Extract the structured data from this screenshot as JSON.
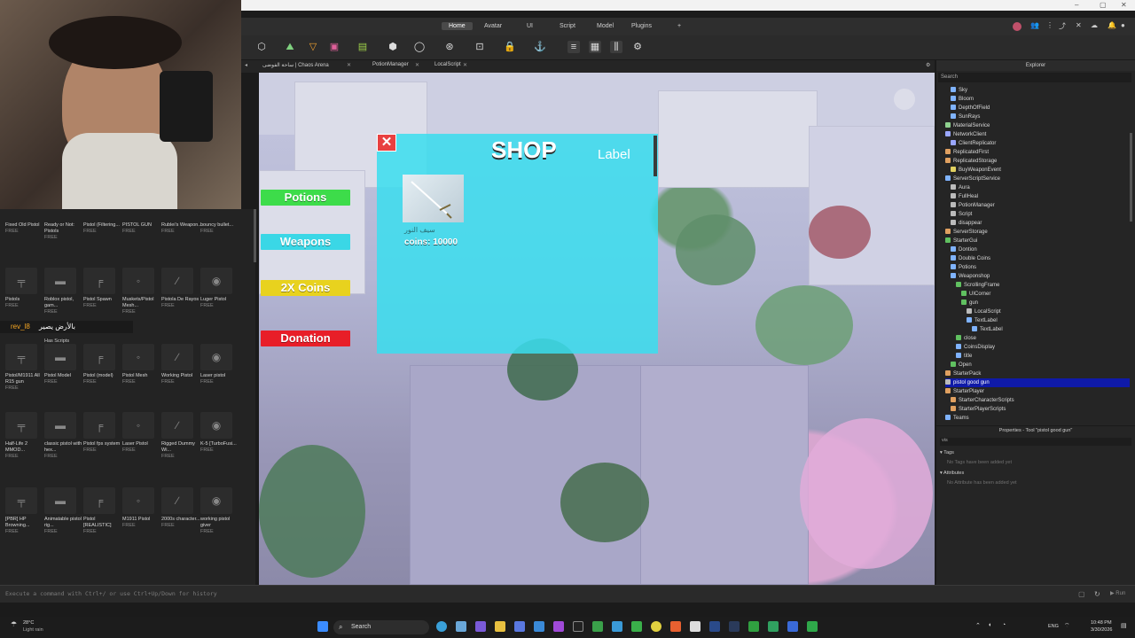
{
  "ribbon": {
    "tabs": [
      "Home",
      "Avatar",
      "UI",
      "Script",
      "Model",
      "Plugins",
      "+"
    ],
    "active": "Home"
  },
  "doc_tabs": [
    "ساحة الفوضى | Chaos Arena",
    "PotionManager",
    "LocalScript"
  ],
  "toolbox": {
    "overlay_user": "rev_l8",
    "overlay_msg": "بالأرض يصير",
    "has_scripts": "Has Scripts",
    "items": [
      {
        "name": "Fixed Old Pistol",
        "price": "FREE"
      },
      {
        "name": "Ready or Not: Pistols",
        "price": "FREE"
      },
      {
        "name": "Pistol (Filtering...",
        "price": "FREE"
      },
      {
        "name": "PISTOL GUN",
        "price": "FREE"
      },
      {
        "name": "Rublei's Weapon...",
        "price": "FREE"
      },
      {
        "name": "bouncy bullet...",
        "price": "FREE"
      },
      {
        "name": "Pistols",
        "price": "FREE"
      },
      {
        "name": "Roblox pistol, gam...",
        "price": "FREE"
      },
      {
        "name": "Pistol Spawn",
        "price": "FREE"
      },
      {
        "name": "Muskets/Pistol Mesh...",
        "price": "FREE"
      },
      {
        "name": "Pistola De Rayos",
        "price": "FREE"
      },
      {
        "name": "Luger Pistol",
        "price": "FREE"
      },
      {
        "name": "Pistol/M1911 All R15 gun",
        "price": "FREE"
      },
      {
        "name": "Pistol Model",
        "price": "FREE"
      },
      {
        "name": "Pistol (model)",
        "price": "FREE"
      },
      {
        "name": "Pistol Mesh",
        "price": "FREE"
      },
      {
        "name": "Working Pistol",
        "price": "FREE"
      },
      {
        "name": "Laser pistol",
        "price": "FREE"
      },
      {
        "name": "Half-Life 2 MMOD...",
        "price": "FREE"
      },
      {
        "name": "classic pistol with hex...",
        "price": "FREE"
      },
      {
        "name": "Pistol fps system",
        "price": "FREE"
      },
      {
        "name": "Laser Pistol",
        "price": "FREE"
      },
      {
        "name": "Rigged Dummy Wi...",
        "price": "FREE"
      },
      {
        "name": "K-5 [TurboFusi...",
        "price": "FREE"
      },
      {
        "name": "[PBR] HP Browning...",
        "price": "FREE"
      },
      {
        "name": "Animatable pistol rig...",
        "price": "FREE"
      },
      {
        "name": "Pistol [REALISTIC]",
        "price": "FREE"
      },
      {
        "name": "M1911 Pistol",
        "price": "FREE"
      },
      {
        "name": "2000s character...",
        "price": "FREE"
      },
      {
        "name": "working pistol giver",
        "price": "FREE"
      }
    ]
  },
  "game_gui": {
    "buttons": [
      {
        "label": "Potions",
        "color": "#3ddc4a"
      },
      {
        "label": "Weapons",
        "color": "#3ad7e6"
      },
      {
        "label": "2X Coins",
        "color": "#e8d21e"
      },
      {
        "label": "Donation",
        "color": "#e81e28"
      }
    ],
    "shop": {
      "title": "SHOP",
      "label": "Label",
      "close": "✕",
      "item_name": "سيف النور",
      "item_price": "coins: 10000"
    }
  },
  "explorer": {
    "title": "Explorer",
    "search_placeholder": "Search",
    "rows": [
      {
        "label": "Sky",
        "indent": 2,
        "color": "#7fb3ff"
      },
      {
        "label": "Bloom",
        "indent": 2,
        "color": "#7fb3ff"
      },
      {
        "label": "DepthOfField",
        "indent": 2,
        "color": "#7fb3ff"
      },
      {
        "label": "SunRays",
        "indent": 2,
        "color": "#7fb3ff"
      },
      {
        "label": "MaterialService",
        "indent": 1,
        "color": "#8fd18f"
      },
      {
        "label": "NetworkClient",
        "indent": 1,
        "color": "#9aa7ff"
      },
      {
        "label": "ClientReplicator",
        "indent": 2,
        "color": "#9aa7ff"
      },
      {
        "label": "ReplicatedFirst",
        "indent": 1,
        "color": "#e0a060"
      },
      {
        "label": "ReplicatedStorage",
        "indent": 1,
        "color": "#e0a060"
      },
      {
        "label": "BuyWeaponEvent",
        "indent": 2,
        "color": "#e0d060"
      },
      {
        "label": "ServerScriptService",
        "indent": 1,
        "color": "#7fb3ff"
      },
      {
        "label": "Aura",
        "indent": 2,
        "color": "#bbbbbb"
      },
      {
        "label": "FullHeal",
        "indent": 2,
        "color": "#bbbbbb"
      },
      {
        "label": "PotionManager",
        "indent": 2,
        "color": "#bbbbbb"
      },
      {
        "label": "Script",
        "indent": 2,
        "color": "#bbbbbb"
      },
      {
        "label": "disappear",
        "indent": 2,
        "color": "#bbbbbb"
      },
      {
        "label": "ServerStorage",
        "indent": 1,
        "color": "#e0a060"
      },
      {
        "label": "StarterGui",
        "indent": 1,
        "color": "#60c060"
      },
      {
        "label": "Dontion",
        "indent": 2,
        "color": "#7fb3ff"
      },
      {
        "label": "Double Coins",
        "indent": 2,
        "color": "#7fb3ff"
      },
      {
        "label": "Potions",
        "indent": 2,
        "color": "#7fb3ff"
      },
      {
        "label": "Weaponshop",
        "indent": 2,
        "color": "#7fb3ff"
      },
      {
        "label": "ScrollingFrame",
        "indent": 3,
        "color": "#60c060"
      },
      {
        "label": "UICorner",
        "indent": 4,
        "color": "#60c060"
      },
      {
        "label": "gun",
        "indent": 4,
        "color": "#60c060"
      },
      {
        "label": "LocalScript",
        "indent": 5,
        "color": "#bbbbbb"
      },
      {
        "label": "TextLabel",
        "indent": 5,
        "color": "#7fb3ff"
      },
      {
        "label": "TextLabel",
        "indent": 6,
        "color": "#7fb3ff"
      },
      {
        "label": "close",
        "indent": 3,
        "color": "#60c060"
      },
      {
        "label": "CoinsDisplay",
        "indent": 3,
        "color": "#7fb3ff"
      },
      {
        "label": "title",
        "indent": 3,
        "color": "#7fb3ff"
      },
      {
        "label": "Open",
        "indent": 2,
        "color": "#60c060"
      },
      {
        "label": "StarterPack",
        "indent": 1,
        "color": "#e0a060"
      },
      {
        "label": "pistol good gun",
        "indent": 1,
        "color": "#bbbbbb",
        "selected": true
      },
      {
        "label": "StarterPlayer",
        "indent": 1,
        "color": "#e0a060"
      },
      {
        "label": "StarterCharacterScripts",
        "indent": 2,
        "color": "#e0a060"
      },
      {
        "label": "StarterPlayerScripts",
        "indent": 2,
        "color": "#e0a060"
      },
      {
        "label": "Teams",
        "indent": 1,
        "color": "#7fb3ff"
      }
    ]
  },
  "properties": {
    "title": "Properties - Tool \"pistol good gun\"",
    "filter": "vis",
    "tags_header": "Tags",
    "tags_empty": "No Tags have been added yet",
    "attr_header": "Attributes",
    "attr_empty": "No Attribute has been added yet"
  },
  "command_bar": {
    "placeholder": "Execute a command with Ctrl+/ or use Ctrl+Up/Down for history"
  },
  "taskbar": {
    "weather_temp": "28°C",
    "weather_desc": "Light rain",
    "search": "Search",
    "lang": "ENG",
    "time": "10:48 PM",
    "date": "3/30/2026"
  }
}
